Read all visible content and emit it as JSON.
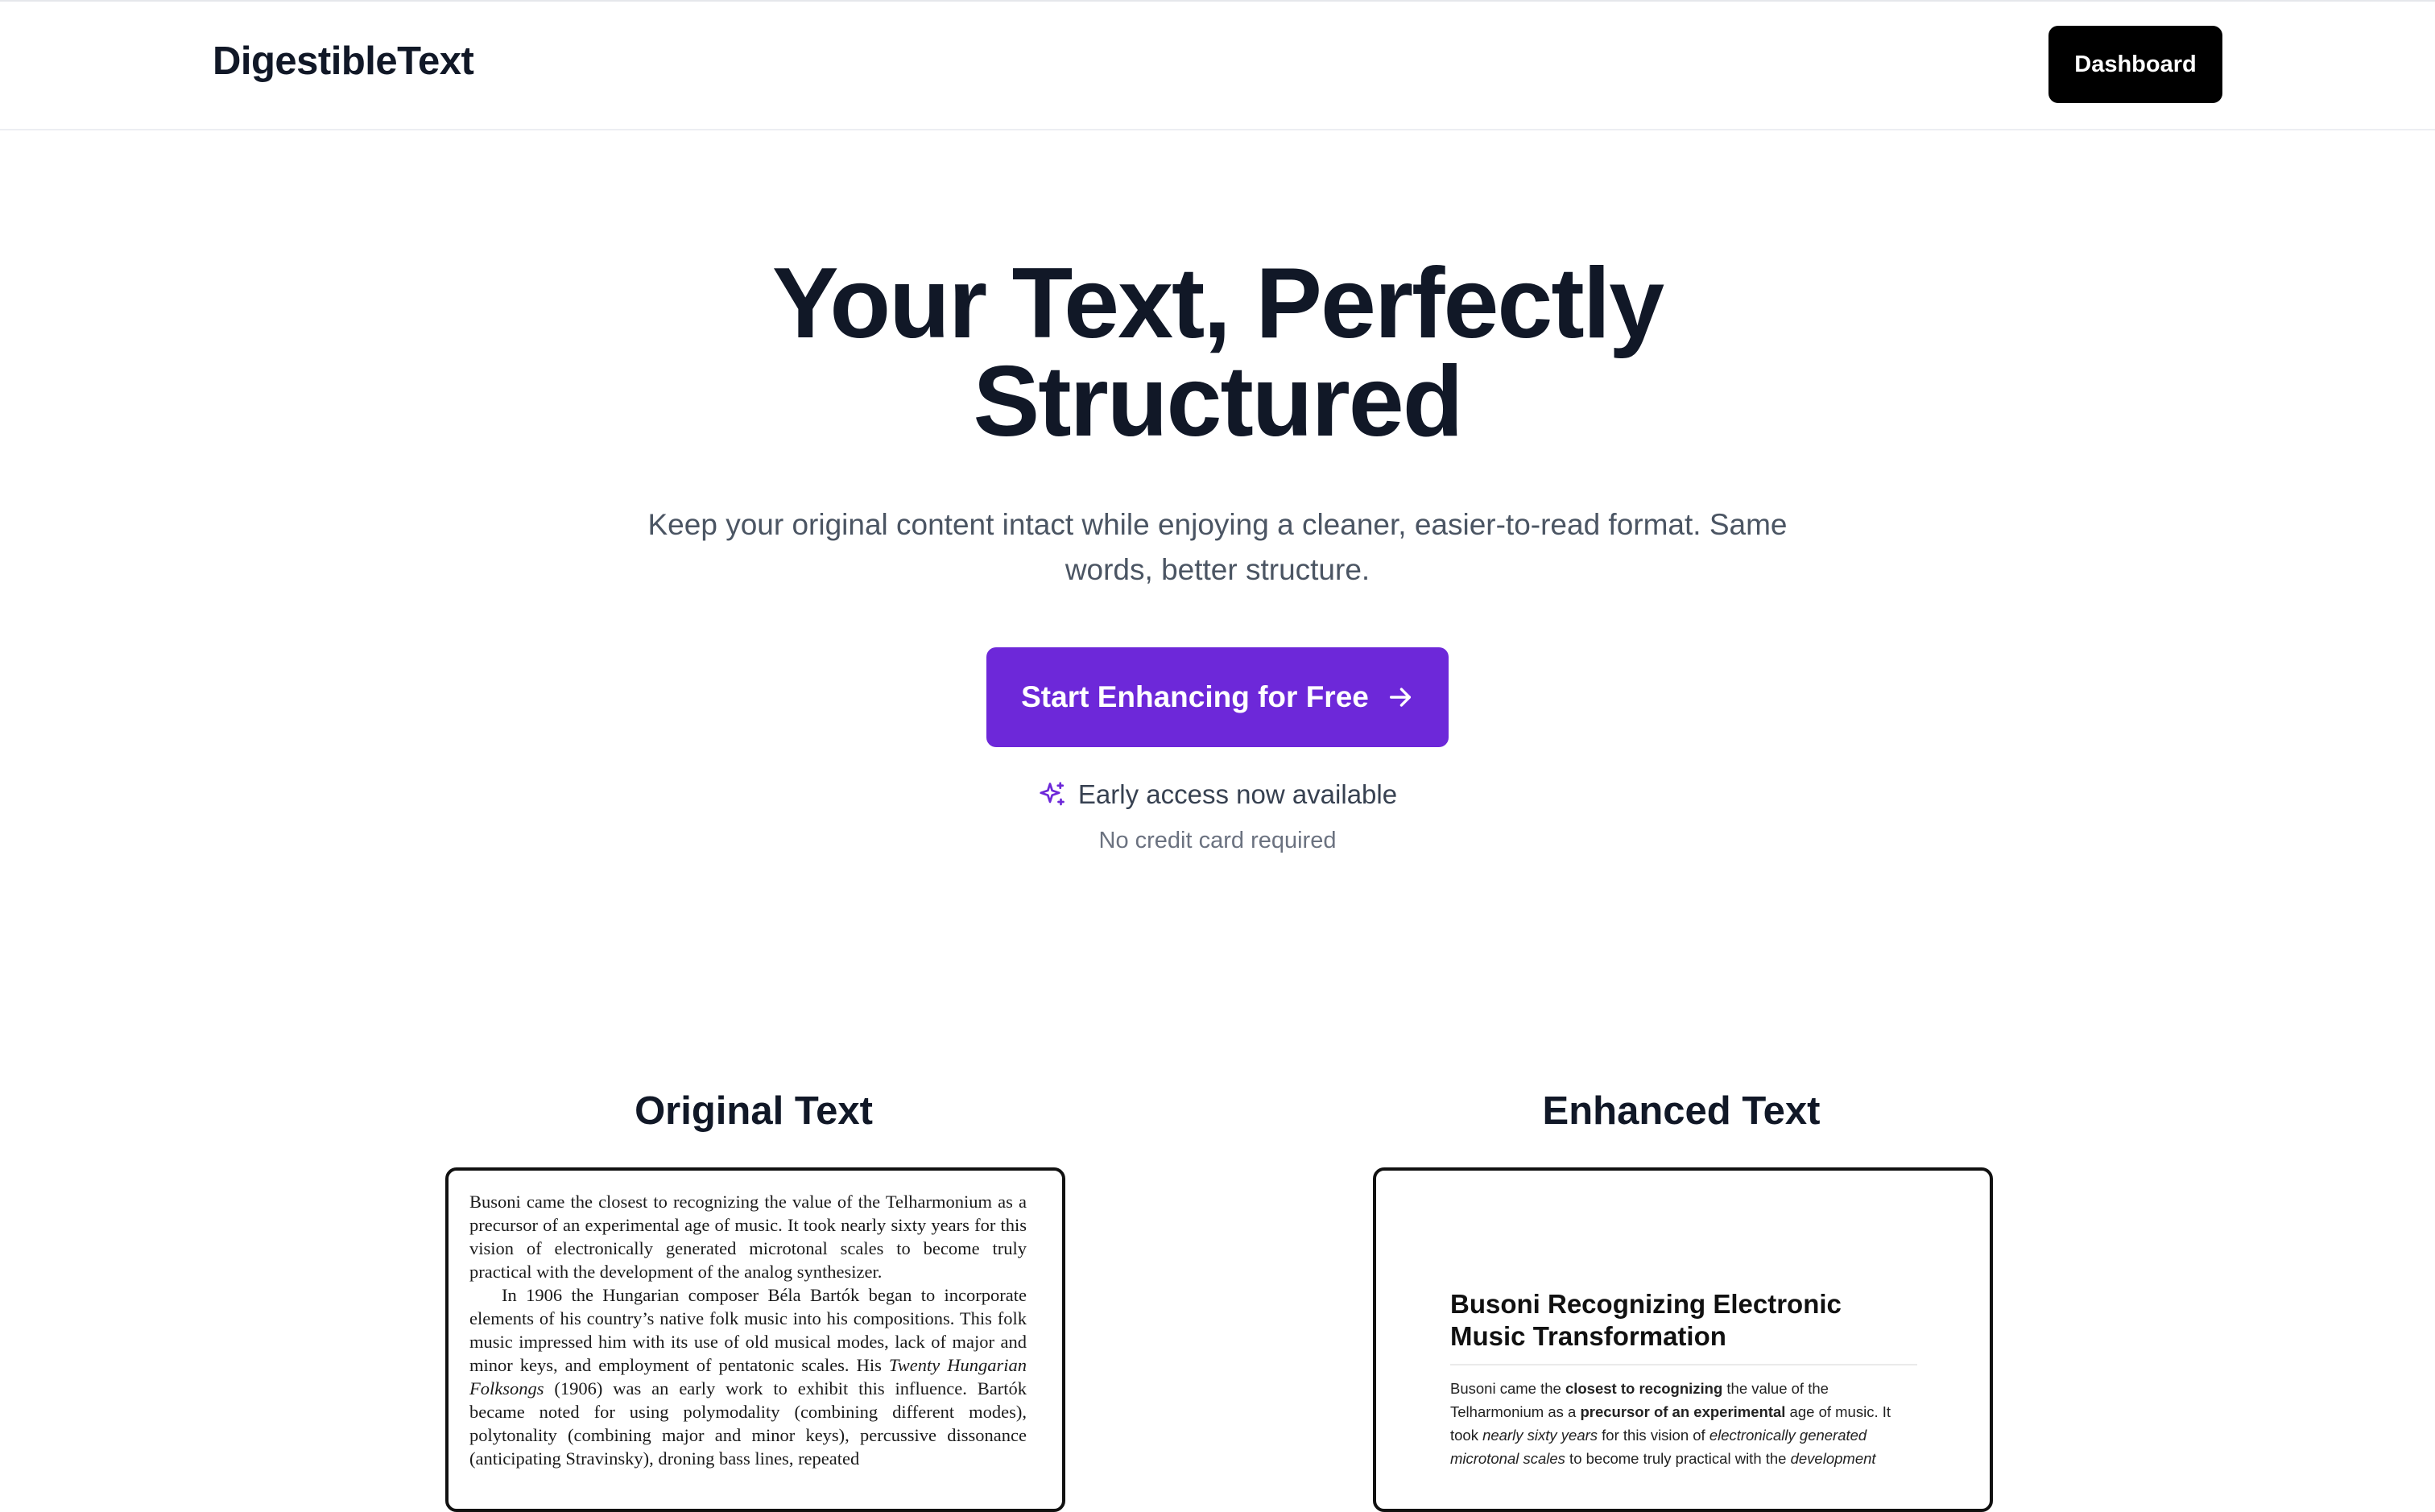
{
  "brand": "DigestibleText",
  "nav": {
    "dashboard_label": "Dashboard"
  },
  "hero": {
    "title_line1": "Your Text, Perfectly",
    "title_line2": "Structured",
    "subtitle": "Keep your original content intact while enjoying a cleaner, easier-to-read format. Same words, better structure.",
    "cta_label": "Start Enhancing for Free",
    "cta_icon": "arrow-right-icon",
    "early_access": "Early access now available",
    "early_icon": "sparkle-icon",
    "no_card": "No credit card required"
  },
  "colors": {
    "accent": "#6d28d9",
    "text": "#111827",
    "muted": "#4b5563"
  },
  "comparison": {
    "original_title": "Original Text",
    "enhanced_title": "Enhanced Text",
    "original_paragraph1": "Busoni came the closest to recognizing the value of the Telharmonium as a precursor of an experimental age of music. It took nearly sixty years for this vision of electronically generated microtonal scales to become truly practical with the development of the analog synthesizer.",
    "original_paragraph2_a": "In 1906 the Hungarian composer Béla Bartók began to incorporate elements of his country’s native folk music into his compositions. This folk music impressed him with its use of old musical modes, lack of major and minor keys, and employment of pentatonic scales. His ",
    "original_paragraph2_italic": "Twenty Hungarian Folksongs",
    "original_paragraph2_b": " (1906) was an early work to exhibit this influence. Bartók became noted for using polymodality (combining different modes), polytonality (combining major and minor keys), percussive dissonance (anticipating Stravinsky), droning bass lines, repeated",
    "enhanced_heading": "Busoni Recognizing Electronic Music Transformation",
    "enhanced_parts": [
      {
        "t": "Busoni came the ",
        "s": "n"
      },
      {
        "t": "closest to recognizing",
        "s": "b"
      },
      {
        "t": " the value of the Telharmonium as a ",
        "s": "n"
      },
      {
        "t": "precursor of an experimental",
        "s": "b"
      },
      {
        "t": " age of music. It took ",
        "s": "n"
      },
      {
        "t": "nearly sixty years",
        "s": "i"
      },
      {
        "t": " for this vision of ",
        "s": "n"
      },
      {
        "t": "electronically generated microtonal scales",
        "s": "i"
      },
      {
        "t": " to become truly practical with the ",
        "s": "n"
      },
      {
        "t": "development",
        "s": "i"
      }
    ]
  }
}
